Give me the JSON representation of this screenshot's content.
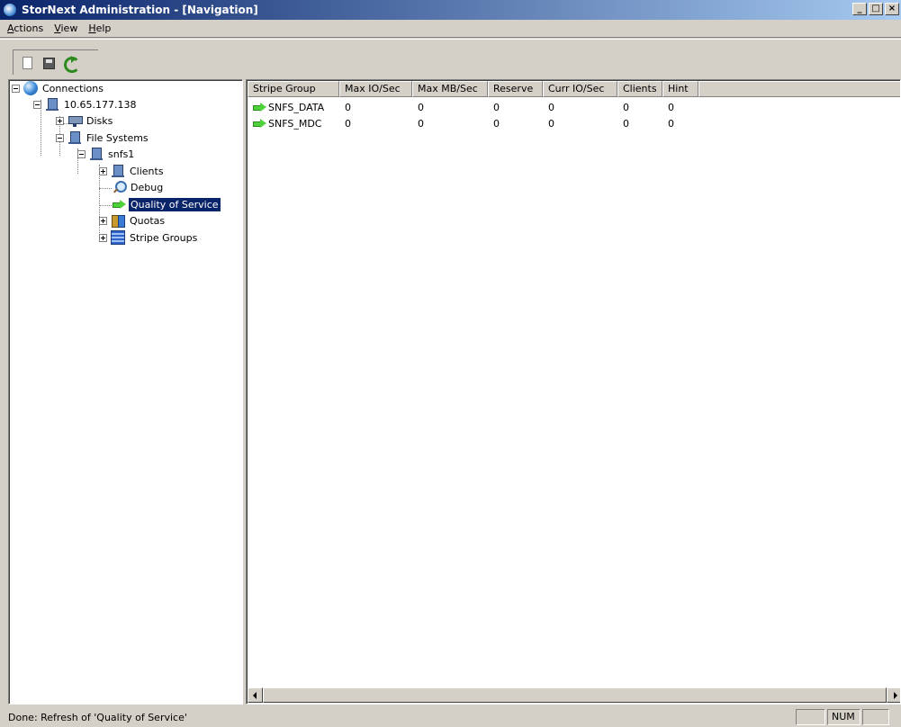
{
  "window": {
    "title": "StorNext Administration - [Navigation]",
    "controls": [
      "_",
      "□",
      "×"
    ]
  },
  "menu": [
    {
      "label": "Actions",
      "mnemonic": "A",
      "rest": "ctions"
    },
    {
      "label": "View",
      "mnemonic": "V",
      "rest": "iew"
    },
    {
      "label": "Help",
      "mnemonic": "H",
      "rest": "elp"
    }
  ],
  "toolbar": {
    "buttons": [
      "new-icon",
      "save-icon",
      "refresh-icon"
    ]
  },
  "tree": {
    "connections": "Connections",
    "host": "10.65.177.138",
    "disks": "Disks",
    "file_systems": "File Systems",
    "fs": "snfs1",
    "clients": "Clients",
    "debug": "Debug",
    "qos": "Quality of Service",
    "quotas": "Quotas",
    "stripe_groups": "Stripe Groups",
    "selected": "Quality of Service"
  },
  "table": {
    "columns": [
      "Stripe Group",
      "Max IO/Sec",
      "Max MB/Sec",
      "Reserve",
      "Curr IO/Sec",
      "Clients",
      "Hint"
    ],
    "rows": [
      [
        "SNFS_DATA",
        "0",
        "0",
        "0",
        "0",
        "0",
        "0"
      ],
      [
        "SNFS_MDC",
        "0",
        "0",
        "0",
        "0",
        "0",
        "0"
      ]
    ]
  },
  "status": {
    "text": "Done: Refresh of 'Quality of Service'",
    "num": "NUM"
  }
}
